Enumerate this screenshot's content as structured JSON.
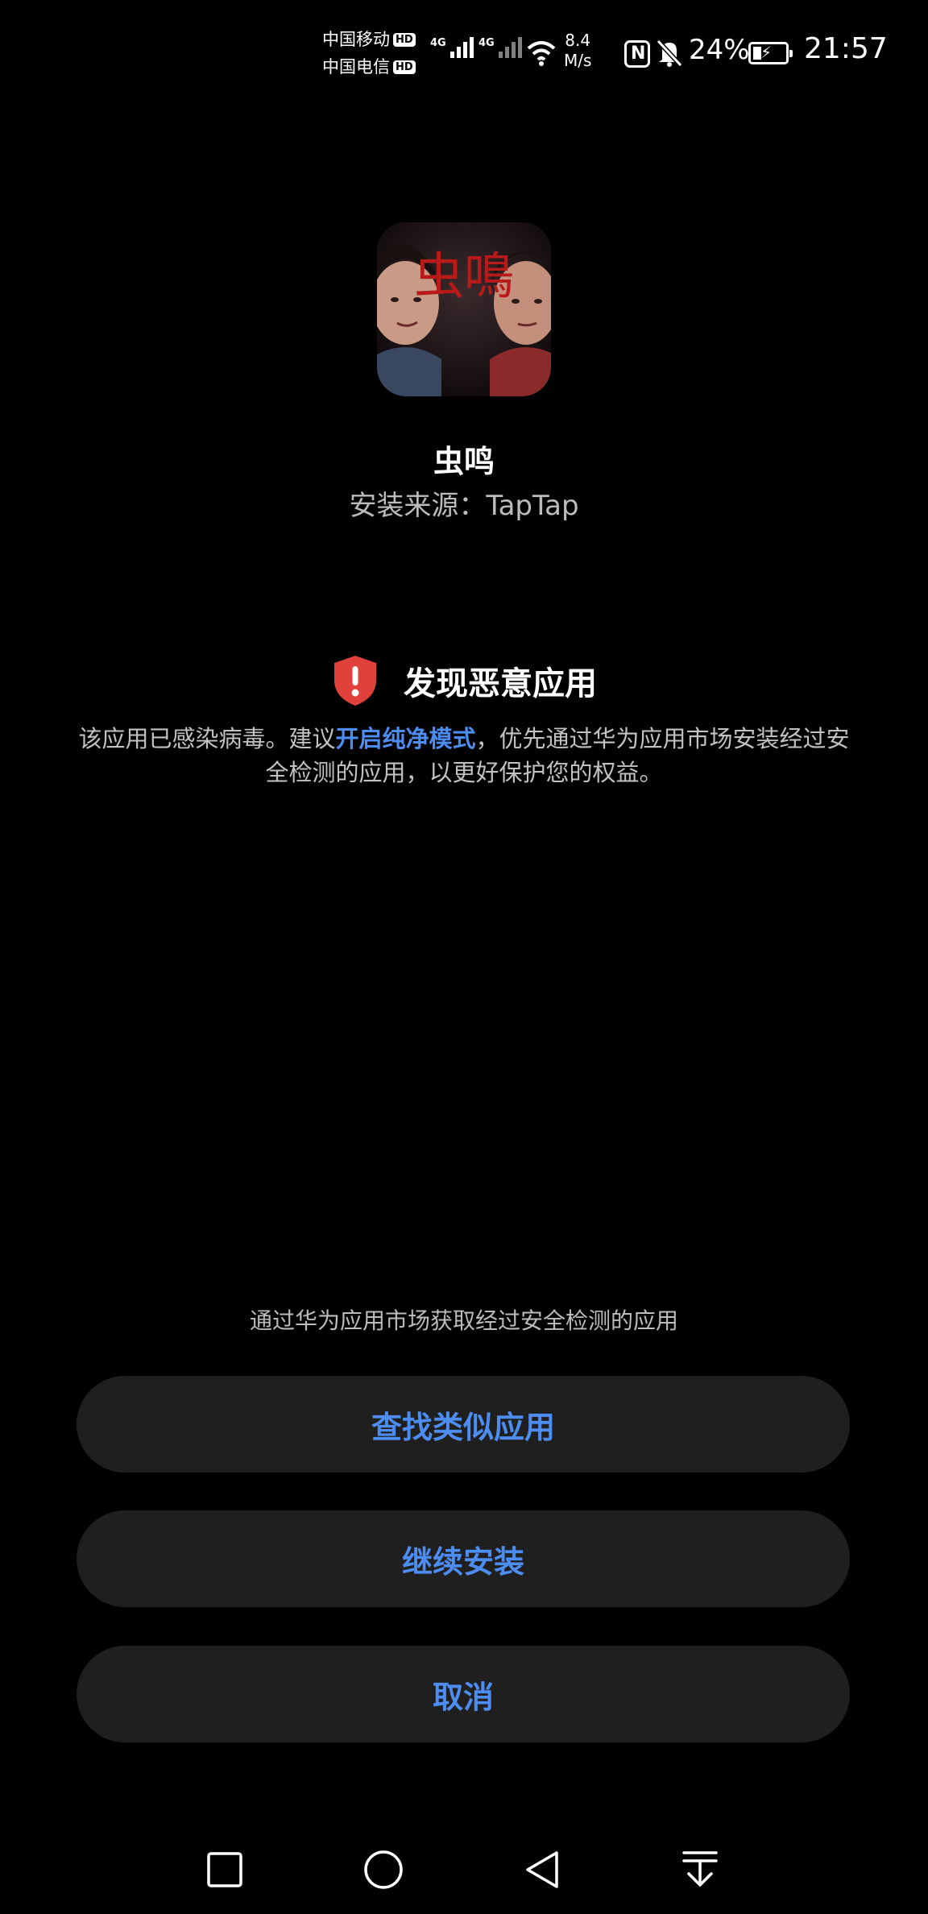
{
  "status_bar": {
    "carrier_1": "中国移动",
    "carrier_2": "中国电信",
    "hd_badge": "HD",
    "network_type": "4G",
    "speed_value": "8.4",
    "speed_unit": "M/s",
    "battery_percent": "24%",
    "time": "21:57",
    "icons": [
      "signal-icon",
      "wifi-icon",
      "nfc-icon",
      "bell-muted-icon",
      "battery-charging-icon"
    ]
  },
  "app": {
    "icon_text": "虫鳴",
    "name": "虫鸣",
    "install_source": "安装来源：TapTap"
  },
  "warning": {
    "icon": "shield-alert-icon",
    "title": "发现恶意应用",
    "desc_before": "该应用已感染病毒。建议",
    "desc_link": "开启纯净模式",
    "desc_after": "，优先通过华为应用市场安装经过安全检测的应用，以更好保护您的权益。"
  },
  "bottom": {
    "market_hint": "通过华为应用市场获取经过安全检测的应用",
    "find_similar_label": "查找类似应用",
    "continue_install_label": "继续安装",
    "cancel_label": "取消"
  },
  "colors": {
    "background": "#000000",
    "button_bg": "#1f1f1f",
    "accent": "#4d8cf0",
    "danger": "#e0413a"
  },
  "nav_bar": {
    "icons": [
      "recents-square-icon",
      "home-circle-icon",
      "back-triangle-icon",
      "notification-pull-icon"
    ]
  }
}
